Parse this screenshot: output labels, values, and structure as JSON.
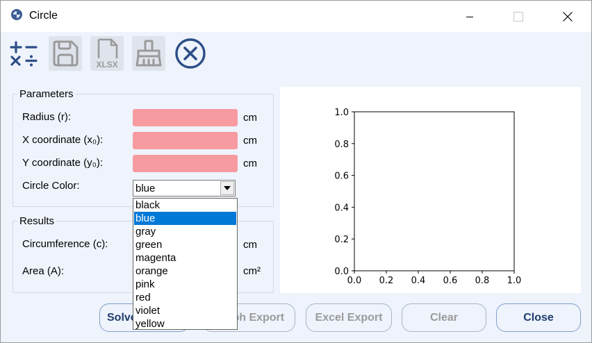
{
  "window": {
    "title": "Circle"
  },
  "toolbar": {
    "items": [
      {
        "name": "calculator-icon"
      },
      {
        "name": "save-icon"
      },
      {
        "name": "xlsx-icon",
        "label": "XLSX"
      },
      {
        "name": "broom-icon"
      },
      {
        "name": "cancel-icon"
      }
    ]
  },
  "parameters": {
    "title": "Parameters",
    "radius_label": "Radius (r):",
    "x_label": "X coordinate (x₀):",
    "y_label": "Y coordinate (y₀):",
    "color_label": "Circle Color:",
    "unit": "cm",
    "radius_value": "",
    "x_value": "",
    "y_value": "",
    "color_selected": "blue",
    "color_options": [
      "black",
      "blue",
      "gray",
      "green",
      "magenta",
      "orange",
      "pink",
      "red",
      "violet",
      "yellow"
    ]
  },
  "results": {
    "title": "Results",
    "circumference_label": "Circumference (c):",
    "area_label": "Area (A):",
    "circ_unit": "cm",
    "area_unit": "cm²"
  },
  "chart_data": {
    "type": "line",
    "x": [],
    "series": [],
    "xlim": [
      0.0,
      1.0
    ],
    "ylim": [
      0.0,
      1.0
    ],
    "xticks": [
      "0.0",
      "0.2",
      "0.4",
      "0.6",
      "0.8",
      "1.0"
    ],
    "yticks": [
      "0.0",
      "0.2",
      "0.4",
      "0.6",
      "0.8",
      "1.0"
    ],
    "grid": false
  },
  "buttons": {
    "solve": "Solve",
    "graph_export": "Graph Export",
    "excel_export": "Excel Export",
    "clear": "Clear",
    "close": "Close"
  },
  "colors": {
    "accent": "#1e3d6d",
    "input_error": "#f79ba1",
    "selection": "#0078d7"
  }
}
